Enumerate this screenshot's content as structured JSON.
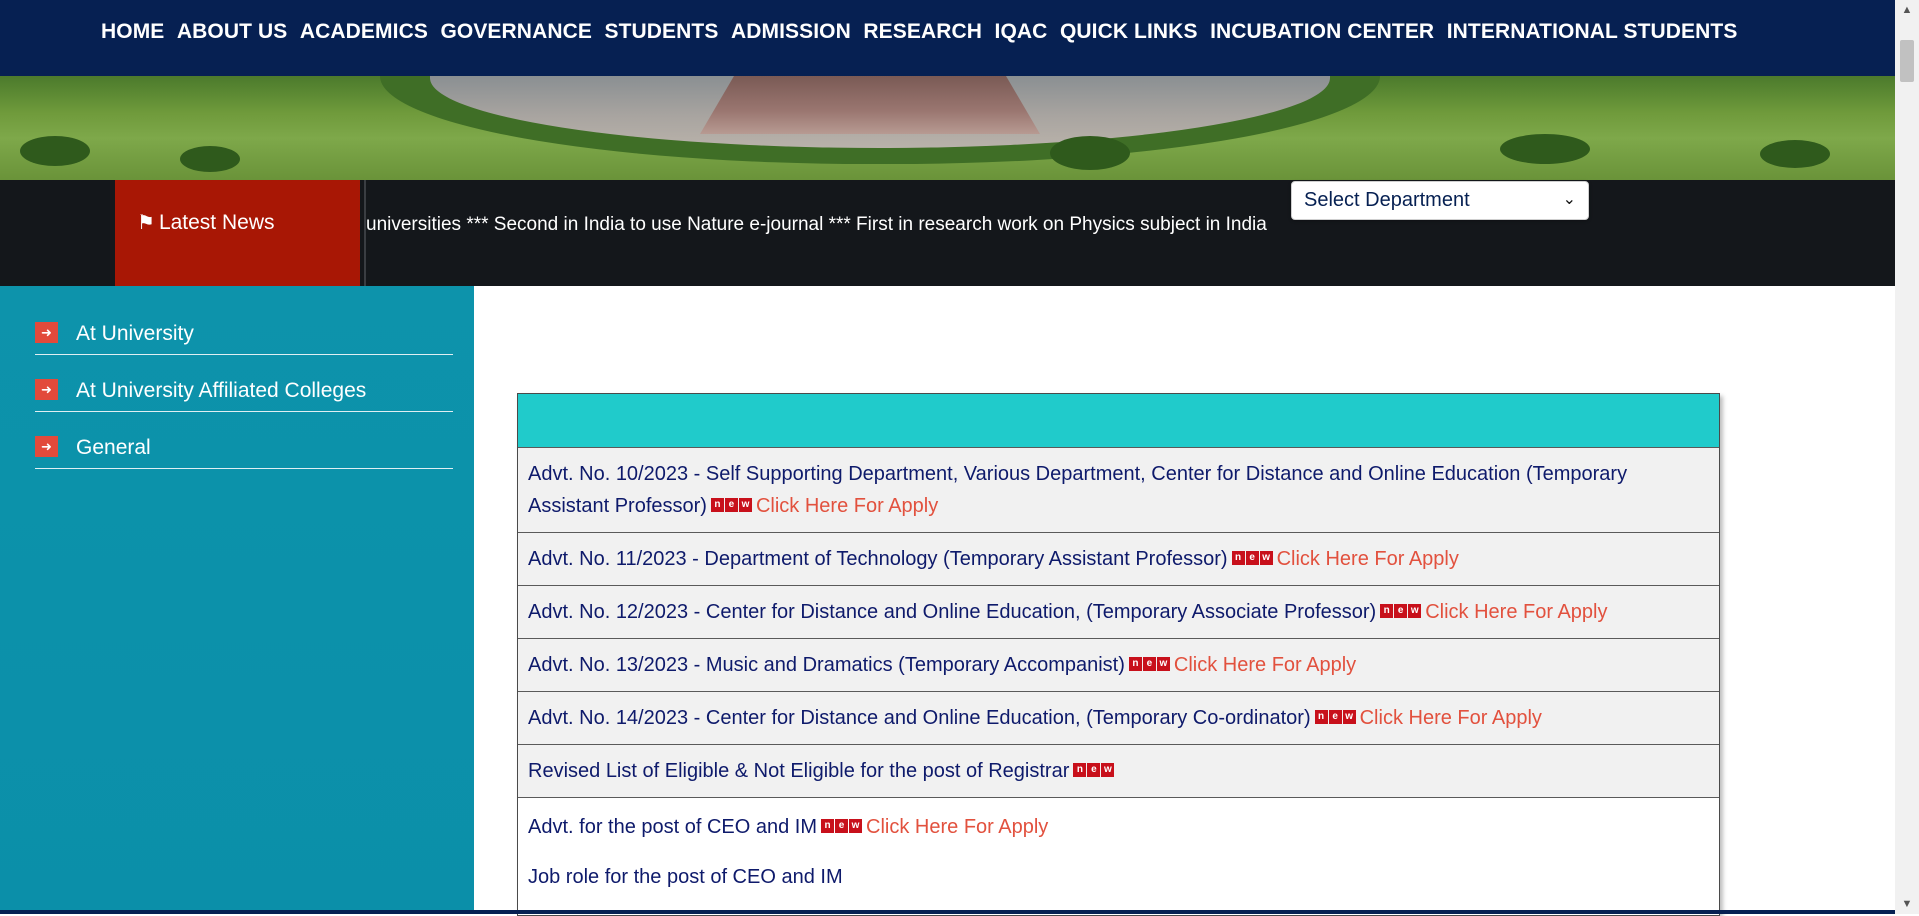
{
  "nav": {
    "items": [
      "HOME",
      "ABOUT US",
      "ACADEMICS",
      "GOVERNANCE",
      "STUDENTS",
      "ADMISSION",
      "RESEARCH",
      "IQAC",
      "QUICK LINKS",
      "INCUBATION CENTER",
      "INTERNATIONAL STUDENTS"
    ]
  },
  "news": {
    "label": "Latest News",
    "icon": "signpost-icon",
    "ticker": "universities *** Second in India to use Nature e-journal *** First in research work on Physics subject in India"
  },
  "department_select": {
    "selected": "Select Department"
  },
  "sidebar": {
    "items": [
      {
        "label": "At University"
      },
      {
        "label": "At University Affiliated Colleges"
      },
      {
        "label": "General"
      }
    ]
  },
  "badge": [
    "n",
    "e",
    "w"
  ],
  "table": {
    "apply_label": "Click Here For Apply",
    "rows": [
      {
        "text": "Advt. No. 10/2023 - Self Supporting Department, Various Department, Center for Distance and Online Education (Temporary Assistant Professor)",
        "is_new": true,
        "has_apply": true
      },
      {
        "text": "Advt. No. 11/2023 - Department of Technology (Temporary Assistant Professor)",
        "is_new": true,
        "has_apply": true
      },
      {
        "text": "Advt. No. 12/2023 - Center for Distance and Online Education, (Temporary Associate Professor)",
        "is_new": true,
        "has_apply": true
      },
      {
        "text": "Advt. No. 13/2023 - Music and Dramatics (Temporary Accompanist)",
        "is_new": true,
        "has_apply": true
      },
      {
        "text": "Advt. No. 14/2023 - Center for Distance and Online Education, (Temporary Co-ordinator)",
        "is_new": true,
        "has_apply": true
      },
      {
        "text": "Revised List of Eligible & Not Eligible for the post of Registrar",
        "is_new": true,
        "has_apply": false
      },
      {
        "text": "Advt. for the post of CEO and IM",
        "is_new": true,
        "has_apply": true
      },
      {
        "text": "Job role for the post of CEO and IM",
        "is_new": false,
        "has_apply": false
      }
    ]
  },
  "colors": {
    "nav_bg": "#062052",
    "news_label_bg": "#a81705",
    "sidebar_bg": "#0d93ab",
    "table_header_bg": "#20cbcb",
    "link_text": "#0e1a6b",
    "apply_text": "#e2513e"
  }
}
